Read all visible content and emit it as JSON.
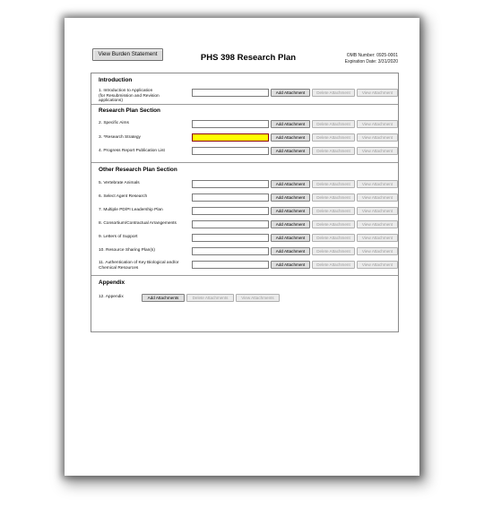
{
  "header": {
    "burden_button": "View Burden Statement",
    "title": "PHS 398 Research Plan",
    "omb_number": "OMB Number: 0925-0001",
    "expiration": "Expiration Date: 3/31/2020"
  },
  "buttons": {
    "add": "Add Attachment",
    "delete": "Delete Attachment",
    "view": "View Attachment",
    "add_multi": "Add Attachments",
    "delete_multi": "Delete Attachments",
    "view_multi": "View Attachments"
  },
  "colors": {
    "required_field": "#ffff00",
    "required_border": "#8a0000"
  },
  "sections": {
    "introduction": {
      "title": "Introduction",
      "rows": [
        {
          "label": "1. Introduction to Application\n(for Resubmission and Revision\napplications)",
          "required": false
        }
      ]
    },
    "research_plan": {
      "title": "Research Plan Section",
      "rows": [
        {
          "label": "2. Specific Aims",
          "required": false
        },
        {
          "label": "3. *Research Strategy",
          "required": true
        },
        {
          "label": "4. Progress Report Publication List",
          "required": false
        }
      ]
    },
    "other": {
      "title": "Other Research Plan Section",
      "rows": [
        {
          "label": "5. Vertebrate Animals",
          "required": false
        },
        {
          "label": "6. Select Agent Research",
          "required": false
        },
        {
          "label": "7. Multiple PD/PI Leadership Plan",
          "required": false
        },
        {
          "label": "8. Consortium/Contractual Arrangements",
          "required": false
        },
        {
          "label": "9. Letters of Support",
          "required": false
        },
        {
          "label": "10. Resource Sharing Plan(s)",
          "required": false
        },
        {
          "label": "11. Authentication of Key Biological and/or\nChemical Resources",
          "required": false
        }
      ]
    },
    "appendix": {
      "title": "Appendix",
      "rows": [
        {
          "label": "12. Appendix"
        }
      ]
    }
  }
}
